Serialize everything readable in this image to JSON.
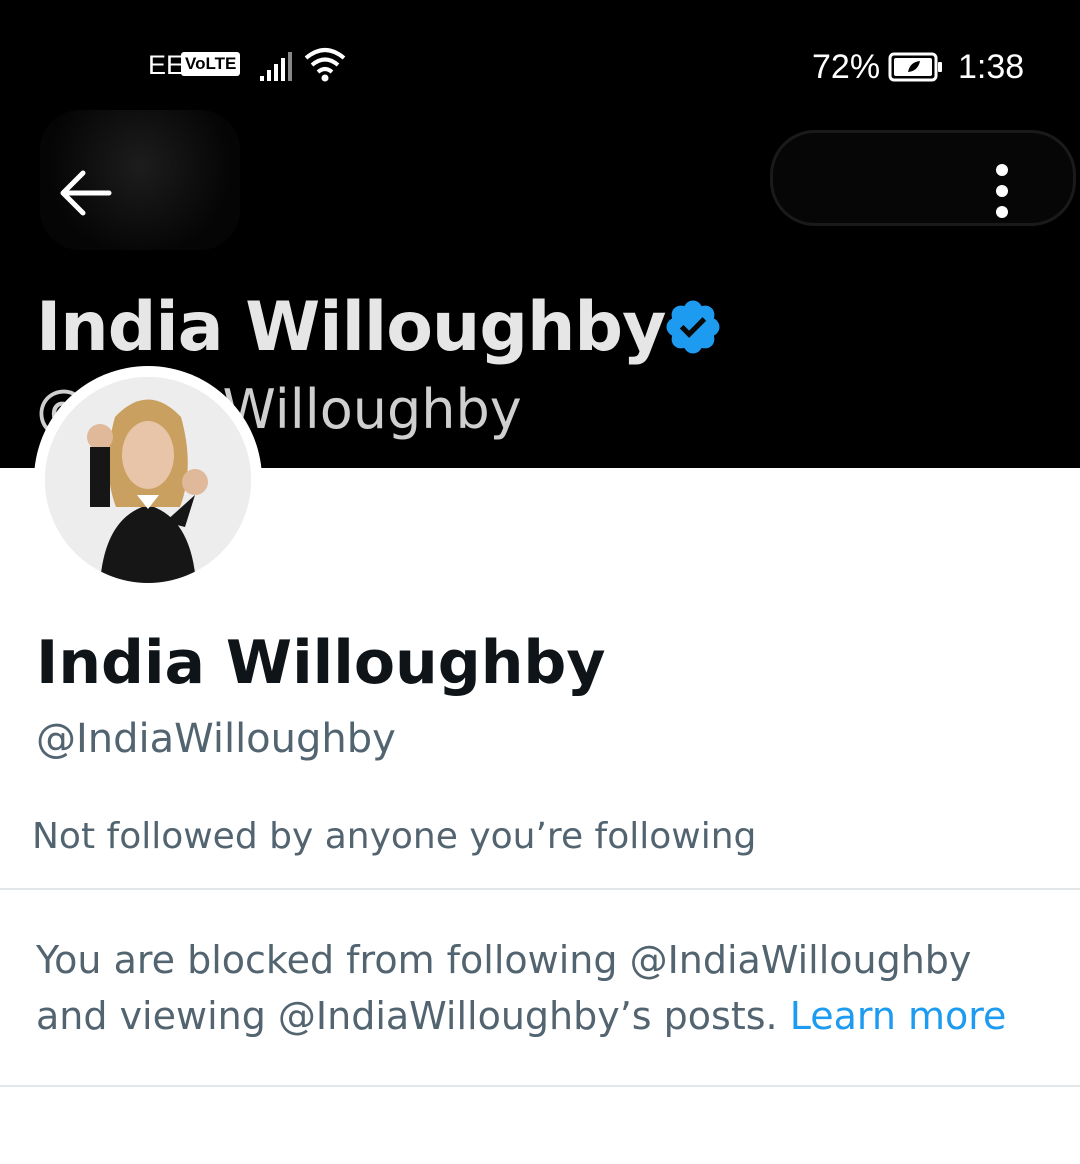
{
  "status_bar": {
    "carrier": "EE",
    "volte": "VoLTE",
    "battery_percent": "72%",
    "time": "1:38",
    "icons": [
      "signal-icon",
      "wifi-icon",
      "battery-icon"
    ]
  },
  "header": {
    "back_icon": "arrow-left-icon",
    "more_icon": "more-vertical-icon"
  },
  "banner": {
    "name": "India Willoughby",
    "handle_partial": "@IndiaWilloughby",
    "verified_icon": "verified-badge-icon"
  },
  "profile": {
    "display_name": "India Willoughby",
    "handle": "@IndiaWilloughby",
    "followed_by": "Not followed by anyone you’re following"
  },
  "blocked": {
    "message": "You are blocked from following @IndiaWilloughby and viewing @IndiaWilloughby’s posts. ",
    "link_label": "Learn more"
  },
  "colors": {
    "link": "#1d9bf0",
    "verified": "#1d9bf0",
    "secondary_text": "#536471",
    "primary_text": "#0f1419"
  }
}
